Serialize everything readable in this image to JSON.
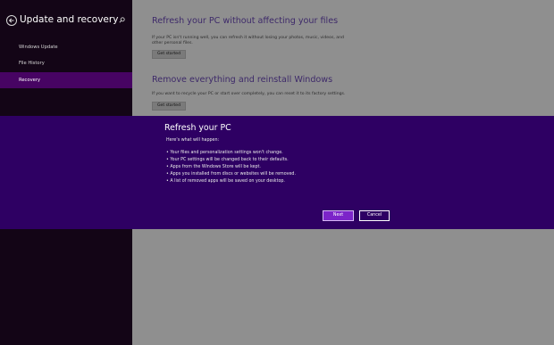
{
  "sidebar": {
    "title": "Update and recovery",
    "items": [
      {
        "label": "Windows Update"
      },
      {
        "label": "File History"
      },
      {
        "label": "Recovery",
        "selected": true
      }
    ]
  },
  "content": {
    "sections": [
      {
        "title": "Refresh your PC without affecting your files",
        "description": "If your PC isn't running well, you can refresh it without losing your photos, music, videos, and other personal files.",
        "button_label": "Get started"
      },
      {
        "title": "Remove everything and reinstall Windows",
        "description": "If you want to recycle your PC or start over completely, you can reset it to its factory settings.",
        "button_label": "Get started"
      }
    ]
  },
  "dialog": {
    "title": "Refresh your PC",
    "subtitle": "Here's what will happen:",
    "bullets": [
      "Your files and personalization settings won't change.",
      "Your PC settings will be changed back to their defaults.",
      "Apps from the Windows Store will be kept.",
      "Apps you installed from discs or websites will be removed.",
      "A list of removed apps will be saved on your desktop."
    ],
    "next_label": "Next",
    "cancel_label": "Cancel"
  },
  "colors": {
    "sidebar_bg": "#130516",
    "selected_item_bg": "#470463",
    "dialog_bg": "#2e0063",
    "next_button_bg": "#7c24c9",
    "content_bg": "#8f8f8f"
  },
  "icons": {
    "back": "back-arrow-icon",
    "search": "search-icon"
  }
}
